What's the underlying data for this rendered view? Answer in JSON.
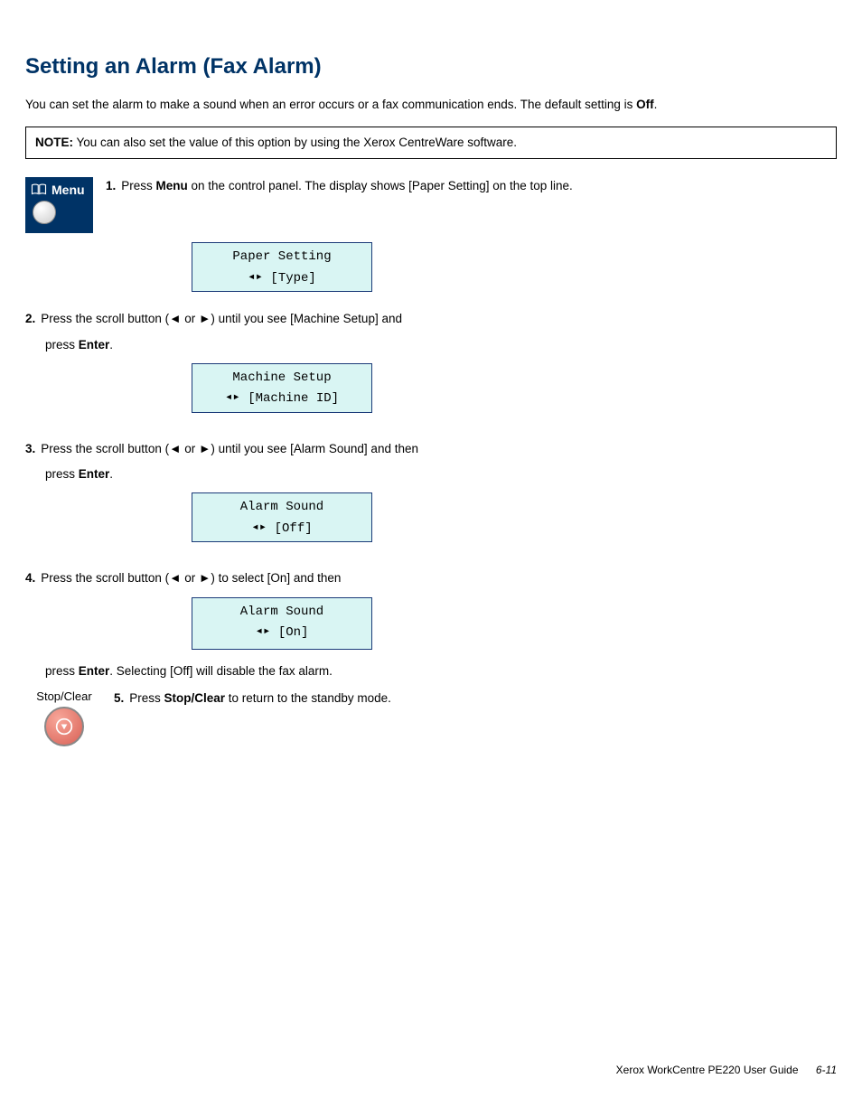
{
  "title": "Setting an Alarm (Fax Alarm)",
  "intro_prefix": "You can set the alarm to make a sound when an error occurs or a fax communication ends. The default setting is ",
  "intro_bold": "Off",
  "intro_suffix": ".",
  "note_label": "NOTE:",
  "note_text": " You can also set the value of this option by using the Xerox CentreWare software.",
  "steps": {
    "s1_prefix": "Press ",
    "s1_bold": "Menu",
    "s1_suffix": " on the control panel. The display shows [Paper Setting] on the top line.",
    "s2_part1_prefix": "Press the scroll button (",
    "s2_part1_mid": " or ",
    "s2_part1_suffix": ") until you see [Machine Setup] and",
    "s2_part2_prefix": "press ",
    "s2_part2_bold": "Enter",
    "s2_part2_suffix": ".",
    "s3_part1_prefix": "Press the scroll button (",
    "s3_part1_mid": " or ",
    "s3_part1_suffix": ") until you see [Alarm Sound] and then",
    "s3_part2_prefix": "press ",
    "s3_part2_bold": "Enter",
    "s3_part2_suffix": ".",
    "s4_part1_prefix": "Press the scroll button (",
    "s4_part1_mid": " or ",
    "s4_part1_suffix": ") to select [On] and then",
    "s4_part2_prefix": "press ",
    "s4_part2_bold": "Enter",
    "s4_part2_suffix": ". Selecting [Off] will disable the fax alarm.",
    "s5_prefix": "Press ",
    "s5_bold": "Stop/Clear",
    "s5_suffix": " to return to the standby mode."
  },
  "arrow_left": "◄",
  "arrow_right": "►",
  "menu_label": "Menu",
  "stop_label": "Stop/Clear",
  "lcd": {
    "l1_top": "Paper Setting",
    "l1_bot_l": "[Type]",
    "l2_top": "Machine Setup",
    "l2_bot_l": "[Machine ID]",
    "l3_top": "Alarm Sound",
    "l3_bot_l": "[Off]",
    "l4_top": "Alarm Sound",
    "l4_bot_l": "[On]"
  },
  "footer_text": "Xerox WorkCentre PE220 User Guide",
  "footer_page": "6-11"
}
